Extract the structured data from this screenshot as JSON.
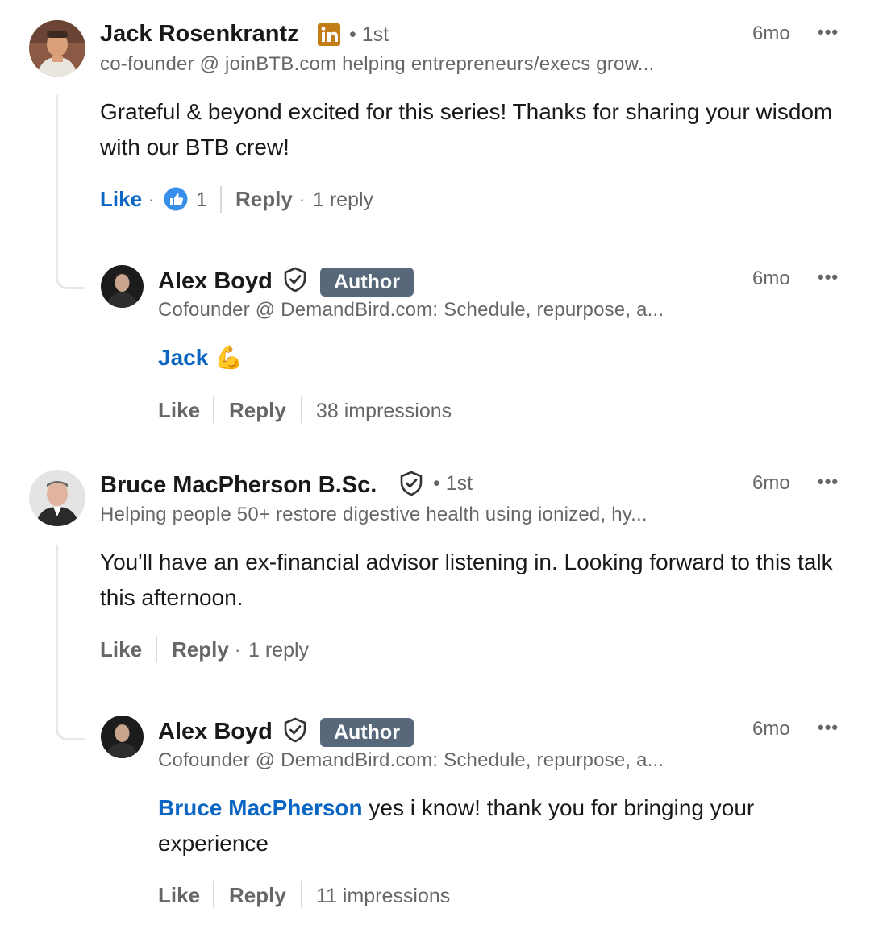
{
  "comments": [
    {
      "author": "Jack Rosenkrantz",
      "degree": "• 1st",
      "headline": "co-founder @ joinBTB.com helping entrepreneurs/execs grow...",
      "time": "6mo",
      "text": "Grateful & beyond excited for this series! Thanks for sharing your wisdom with our BTB crew!",
      "like_label": "Like",
      "reaction_count": "1",
      "reply_label": "Reply",
      "reply_count": "1 reply",
      "reply": {
        "author": "Alex Boyd",
        "badge": "Author",
        "headline": "Cofounder @ DemandBird.com: Schedule, repurpose, a...",
        "time": "6mo",
        "mention": "Jack",
        "emoji": "💪",
        "like_label": "Like",
        "reply_label": "Reply",
        "impressions": "38 impressions"
      }
    },
    {
      "author": "Bruce MacPherson B.Sc.",
      "degree": "• 1st",
      "headline": "Helping people 50+ restore digestive health using ionized, hy...",
      "time": "6mo",
      "text": "You'll have an ex-financial advisor listening in. Looking forward to this talk this afternoon.",
      "like_label": "Like",
      "reply_label": "Reply",
      "reply_count": "1 reply",
      "reply": {
        "author": "Alex Boyd",
        "badge": "Author",
        "headline": "Cofounder @ DemandBird.com: Schedule, repurpose, a...",
        "time": "6mo",
        "mention": "Bruce MacPherson",
        "text": "yes i know! thank you for bringing your experience",
        "like_label": "Like",
        "reply_label": "Reply",
        "impressions": "11 impressions"
      }
    }
  ],
  "more_menu": "•••",
  "colors": {
    "link": "#0a66c2",
    "badge": "#56687a",
    "linkedin_premium": "#c37d16"
  },
  "icons": [
    "linkedin-premium-icon",
    "verified-shield-icon",
    "like-reaction-icon",
    "more-options-icon"
  ]
}
